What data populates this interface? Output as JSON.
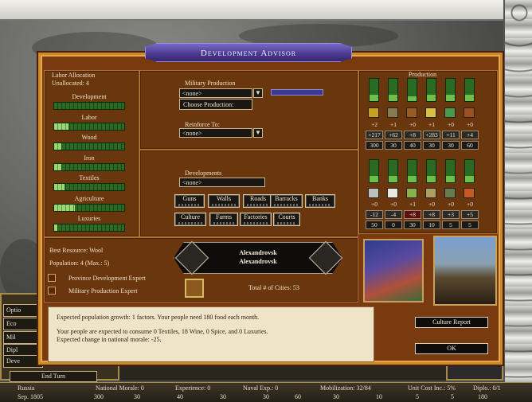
{
  "hud": {
    "buttons": [
      "Optio",
      "Eco",
      "Mil",
      "Dipl",
      "Deve"
    ],
    "end_turn": "End Turn"
  },
  "status": {
    "nation": "Russia",
    "date": "Sep. 1805",
    "national_morale": "National Morale: 0",
    "experience": "Experience: 0",
    "naval_exp": "Naval Exp.: 0",
    "mobilization": "Mobilization: 32/84",
    "unit_cost": "Unit Cost Inc.: 5%",
    "diplo": "Diplo.: 0/1",
    "resource_counts": [
      "300",
      "30",
      "40",
      "30",
      "30",
      "60",
      "30",
      "10",
      "5",
      "5",
      "180"
    ]
  },
  "dialog": {
    "title": "Development Advisor",
    "labor": {
      "title": "Labor Allocation",
      "unallocated": "Unallocated: 4",
      "rows": [
        {
          "label": "Development",
          "fill": 0
        },
        {
          "label": "Labor",
          "fill": 0.2
        },
        {
          "label": "Wood",
          "fill": 0.1
        },
        {
          "label": "Iron",
          "fill": 0.1
        },
        {
          "label": "Textiles",
          "fill": 0.15
        },
        {
          "label": "Agriculture",
          "fill": 0.3
        },
        {
          "label": "Luxuries",
          "fill": 0.05
        }
      ]
    },
    "military": {
      "title": "Military Production",
      "selected": "<none>",
      "choose_label": "Choose Production:",
      "reinforce_label": "Reinforce To:",
      "reinforce_selected": "<none>"
    },
    "developments": {
      "title": "Developments",
      "selected": "<none>",
      "buttons": [
        "Guns",
        "Walls",
        "Roads",
        "Barracks",
        "Banks",
        "Culture",
        "Farms",
        "Factories",
        "Courts"
      ]
    },
    "production": {
      "title": "Production",
      "top": {
        "icons": [
          "resource-gold-icon",
          "resource-tools-icon",
          "resource-horse-icon",
          "resource-wheat-icon",
          "resource-flag-icon",
          "resource-wood-icon"
        ],
        "icon_colors": [
          "#c8a020",
          "#8a7a50",
          "#9a5a20",
          "#d8c040",
          "#4a9a4a",
          "#a05020"
        ],
        "fills": [
          0.3,
          0.3,
          0.2,
          0.3,
          0.3,
          0.3
        ],
        "deltas": [
          "+2",
          "+1",
          "+0",
          "+1",
          "+0",
          "+0"
        ],
        "totals": [
          "+217",
          "+62",
          "+8",
          "+283",
          "+11",
          "+4"
        ],
        "caps": [
          "300",
          "30",
          "40",
          "30",
          "30",
          "60"
        ]
      },
      "bottom": {
        "icons": [
          "resource-sheep-icon",
          "resource-cotton-icon",
          "resource-bottle-icon",
          "resource-paper-icon",
          "resource-musket-icon",
          "resource-shield-icon"
        ],
        "icon_colors": [
          "#c0c0b8",
          "#e8e8e0",
          "#8ab04a",
          "#b0a060",
          "#6a7a4a",
          "#c85a20"
        ],
        "fills": [
          0.3,
          0.3,
          0.3,
          0.3,
          0.3,
          0.3
        ],
        "deltas": [
          "+0",
          "+0",
          "+1",
          "+0",
          "+0",
          "+0"
        ],
        "totals": [
          "-12",
          "-4",
          "+8",
          "+8",
          "+3",
          "+5"
        ],
        "caps": [
          "50",
          "0",
          "30",
          "10",
          "5",
          "5"
        ]
      }
    },
    "province": {
      "best_resource": "Best Resource: Wool",
      "population": "Population: 4   (Max.: 5)",
      "expert_dev": "Province Development Expert",
      "expert_mil": "Military Production Expert",
      "city_line1": "Alexandrovsk",
      "city_line2": "Alexandrovsk",
      "total_cities": "Total # of Cities: 53"
    },
    "message": {
      "line1": "Expected population growth:  1 factors.  Your people need 180 food each month.",
      "line2": "Your people are expected to consume 0 Textiles, 18 Wine, 0 Spice, and 0 Luxuries.",
      "line3": "Expected change in national morale: -25."
    },
    "culture_report": "Culture Report",
    "ok": "OK"
  }
}
